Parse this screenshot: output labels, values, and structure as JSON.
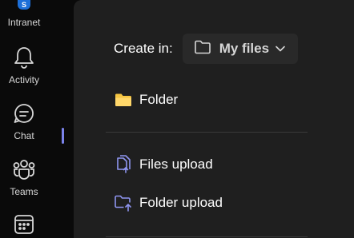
{
  "rail": {
    "items": [
      {
        "label": "Intranet",
        "icon": "intranet-icon"
      },
      {
        "label": "Activity",
        "icon": "bell-icon"
      },
      {
        "label": "Chat",
        "icon": "chat-icon"
      },
      {
        "label": "Teams",
        "icon": "teams-icon"
      },
      {
        "label": "",
        "icon": "calendar-icon"
      }
    ]
  },
  "create": {
    "label": "Create in:",
    "location": "My files"
  },
  "menu": {
    "folder": "Folder",
    "files_upload": "Files upload",
    "folder_upload": "Folder upload"
  },
  "colors": {
    "accent": "#7b83eb",
    "folder_yellow": "#f5c542",
    "panel": "#1f1f1f",
    "rail": "#0a0a0a"
  }
}
